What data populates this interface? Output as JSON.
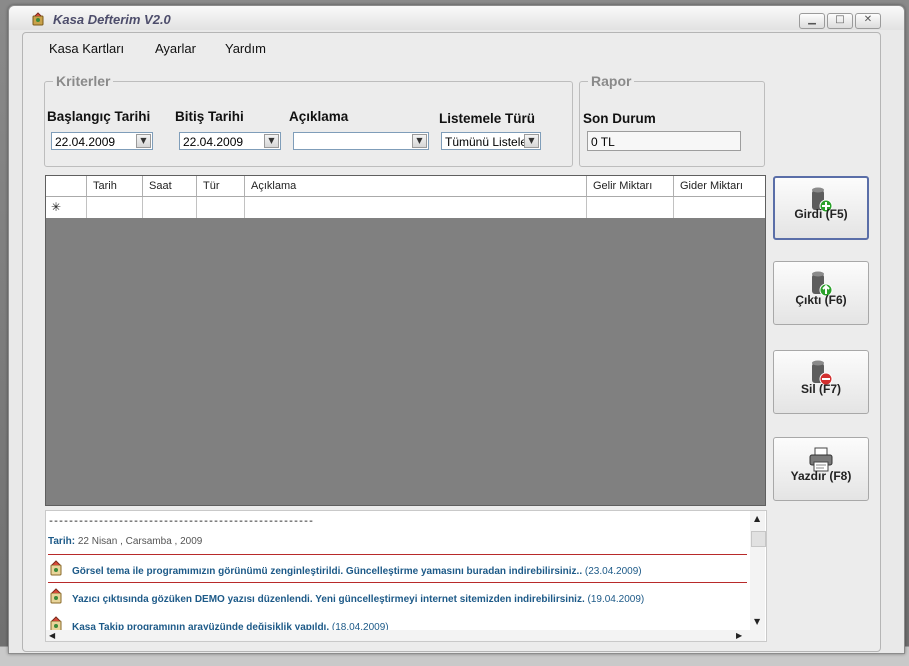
{
  "window": {
    "title": "Kasa Defterim V2.0",
    "controls": {
      "minimize": "▁",
      "maximize": "□",
      "close": "✕"
    }
  },
  "menu": [
    "Kasa Kartları",
    "Ayarlar",
    "Yardım"
  ],
  "kriterler": {
    "legend": "Kriterler",
    "start_label": "Başlangıç Tarihi",
    "start_value": "22.04.2009",
    "end_label": "Bitiş Tarihi",
    "end_value": "22.04.2009",
    "desc_label": "Açıklama",
    "desc_value": "",
    "list_label": "Listemele Türü",
    "list_value": "Tümünü Listele"
  },
  "rapor": {
    "legend": "Rapor",
    "status_label": "Son Durum",
    "status_value": "0 TL"
  },
  "grid": {
    "columns": [
      "",
      "Tarih",
      "Saat",
      "Tür",
      "Açıklama",
      "Gelir Miktarı",
      "Gider Miktarı"
    ],
    "new_row_marker": "✳"
  },
  "buttons": [
    {
      "label": "Girdi (F5)",
      "icon": "add-entry-icon",
      "accent": "#2aa12a"
    },
    {
      "label": "Çıktı (F6)",
      "icon": "output-entry-icon",
      "accent": "#2aa12a"
    },
    {
      "label": "Sil (F7)",
      "icon": "delete-entry-icon",
      "accent": "#d23030"
    },
    {
      "label": "Yazdır (F8)",
      "icon": "printer-icon",
      "accent": "#555555"
    }
  ],
  "news": {
    "dashes": "-----------------------------------------------------",
    "date_prefix": "Tarih:",
    "date_value": "22 Nisan , Carsamba , 2009",
    "items": [
      {
        "text": "Görsel tema ile programımızın görünümü zenginleştirildi. Güncelleştirme yamasını buradan indirebilirsiniz..",
        "date": "(23.04.2009)"
      },
      {
        "text": "Yazıcı çıktısında gözüken DEMO yazısı düzenlendi. Yeni güncelleştirmeyi internet sitemizden indirebilirsiniz.",
        "date": "(19.04.2009)"
      },
      {
        "text": "Kasa Takip programının arayüzünde değişiklik yapıldı.",
        "date": "(18.04.2009)"
      }
    ]
  },
  "colors": {
    "accent": "#5a6ea8",
    "news_text": "#1d5a88",
    "separator": "#b82a2a",
    "grid_bg": "#808080"
  }
}
